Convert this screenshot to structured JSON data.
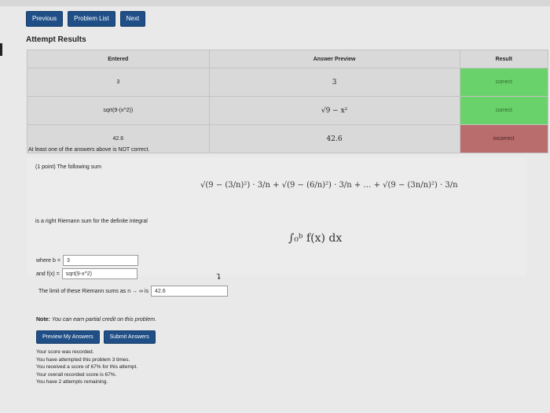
{
  "nav": {
    "previous": "Previous",
    "problem_list": "Problem List",
    "next": "Next"
  },
  "attempt_title": "Attempt Results",
  "results": {
    "headers": {
      "entered": "Entered",
      "preview": "Answer Preview",
      "result": "Result"
    },
    "rows": [
      {
        "entered": "3",
        "preview": "3",
        "result": "correct"
      },
      {
        "entered": "sqrt(9-(x^2))",
        "preview": "√9 − x²",
        "result": "correct"
      },
      {
        "entered": "42.6",
        "preview": "42.6",
        "result": "incorrect"
      }
    ]
  },
  "not_correct_msg": "At least one of the answers above is NOT correct.",
  "problem": {
    "head": "(1 point) The following sum",
    "sum_formula": "√(9 − (3/n)²) · 3/n + √(9 − (6/n)²) · 3/n + … + √(9 − (3n/n)²) · 3/n",
    "riemann_text": "is a right Riemann sum for the definite integral",
    "integral": "∫₀ᵇ f(x) dx",
    "b_label": "where b =",
    "b_value": "3",
    "f_label": "and f(x) =",
    "f_value": "sqrt(9-x^2)",
    "limit_label": "The limit of these Riemann sums as n → ∞ is",
    "limit_value": "42.6"
  },
  "note": {
    "label": "Note:",
    "text": "You can earn partial credit on this problem."
  },
  "buttons": {
    "preview": "Preview My Answers",
    "submit": "Submit Answers"
  },
  "status_lines": [
    "Your score was recorded.",
    "You have attempted this problem 3 times.",
    "You received a score of 67% for this attempt.",
    "Your overall recorded score is 67%.",
    "You have 2 attempts remaining."
  ],
  "colors": {
    "nav": "#1f4f86",
    "correct": "#6ad26a",
    "incorrect": "#b96d6d"
  }
}
